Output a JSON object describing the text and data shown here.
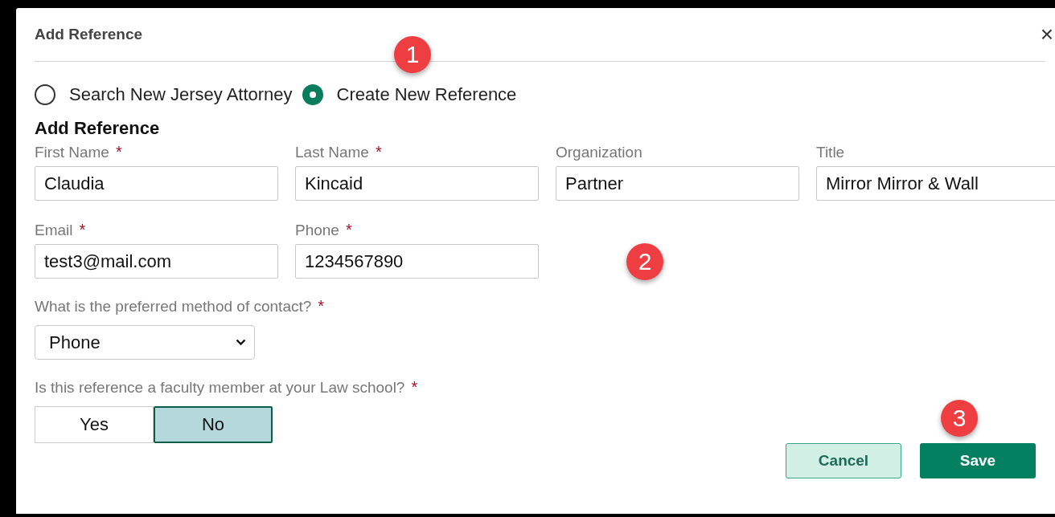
{
  "dialog": {
    "title": "Add Reference",
    "close": "×"
  },
  "mode_options": [
    {
      "label": "Search New Jersey Attorney",
      "selected": false
    },
    {
      "label": "Create New Reference",
      "selected": true
    }
  ],
  "section_title": "Add Reference",
  "fields": [
    {
      "label": "First Name",
      "required_mark": "*",
      "value": "Claudia"
    },
    {
      "label": "Last Name",
      "required_mark": "*",
      "value": "Kincaid"
    },
    {
      "label": "Organization",
      "value": "Partner"
    },
    {
      "label": "Title",
      "value": "Mirror Mirror & Wall"
    },
    {
      "label": "Email",
      "required_mark": "*",
      "value": "test3@mail.com"
    },
    {
      "label": "Phone",
      "required_mark": "*",
      "value": "1234567890"
    }
  ],
  "contact_method": {
    "label": "What is the preferred method of contact?",
    "required_mark": "*",
    "value": "Phone"
  },
  "faculty_question": {
    "label": "Is this reference a faculty member at your Law school?",
    "required_mark": "*",
    "options": [
      {
        "label": "Yes",
        "selected": false
      },
      {
        "label": "No",
        "selected": true
      }
    ]
  },
  "buttons": [
    {
      "label": "Cancel",
      "kind": "secondary"
    },
    {
      "label": "Save",
      "kind": "primary"
    }
  ],
  "callouts": [
    "1",
    "2",
    "3"
  ]
}
